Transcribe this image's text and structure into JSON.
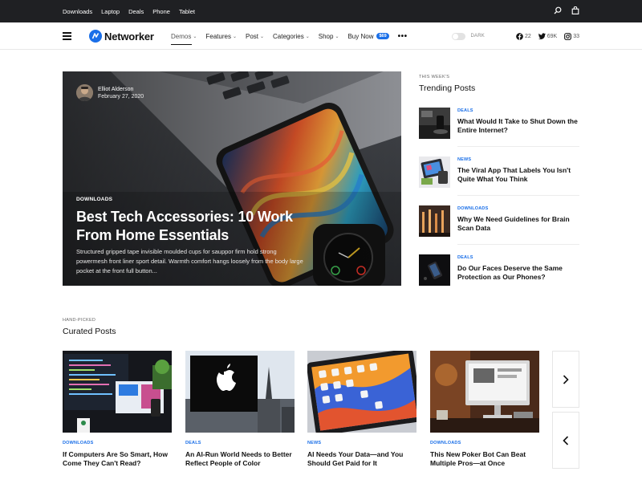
{
  "topbar": {
    "links": [
      "Downloads",
      "Laptop",
      "Deals",
      "Phone",
      "Tablet"
    ],
    "icons": [
      "search-icon",
      "bag-icon"
    ]
  },
  "nav": {
    "brand": "Networker",
    "menu": [
      "Demos",
      "Features",
      "Post",
      "Categories",
      "Shop"
    ],
    "buy_now": "Buy Now",
    "buy_badge": "$69",
    "more": "•••",
    "dark_label": "DARK",
    "social": {
      "facebook": "22",
      "twitter": "69K",
      "instagram": "33"
    }
  },
  "hero": {
    "author": "Elliot Alderson",
    "date": "February 27, 2020",
    "category": "DOWNLOADS",
    "title": "Best Tech Accessories: 10 Work From Home Essentials",
    "excerpt": "Structured gripped tape invisible moulded cups for sauppor firm hold strong powermesh front liner sport detail. Warmth comfort hangs loosely from the body large pocket at the front full button..."
  },
  "trending": {
    "kicker": "THIS WEEK'S",
    "title": "Trending Posts",
    "items": [
      {
        "category": "DEALS",
        "title": "What Would It Take to Shut Down the Entire Internet?"
      },
      {
        "category": "NEWS",
        "title": "The Viral App That Labels You Isn't Quite What You Think"
      },
      {
        "category": "DOWNLOADS",
        "title": "Why We Need Guidelines for Brain Scan Data"
      },
      {
        "category": "DEALS",
        "title": "Do Our Faces Deserve the Same Protection as Our Phones?"
      }
    ]
  },
  "curated": {
    "kicker": "HAND-PICKED",
    "title": "Curated Posts",
    "items": [
      {
        "category": "DOWNLOADS",
        "title": "If Computers Are So Smart, How Come They Can't Read?"
      },
      {
        "category": "DEALS",
        "title": "An AI-Run World Needs to Better Reflect People of Color"
      },
      {
        "category": "NEWS",
        "title": "AI Needs Your Data—and You Should Get Paid for It"
      },
      {
        "category": "DOWNLOADS",
        "title": "This New Poker Bot Can Beat Multiple Pros—at Once"
      }
    ]
  },
  "colors": {
    "accent": "#1a6fe8",
    "topbar": "#1f2023"
  }
}
